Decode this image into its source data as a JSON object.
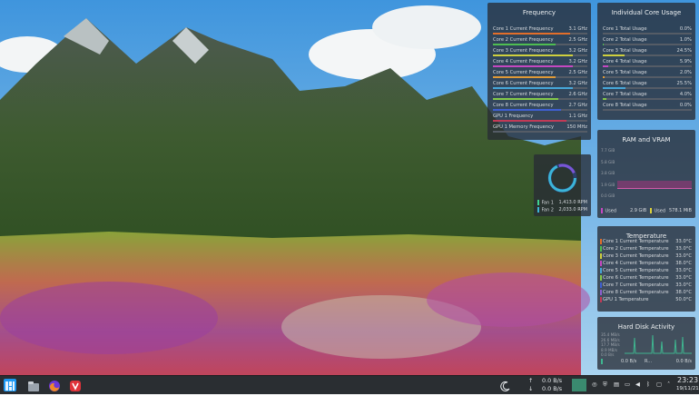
{
  "widgets": {
    "frequency": {
      "title": "Frequency",
      "rows": [
        {
          "label": "Core 1 Current Frequency",
          "value": "3.1 GHz",
          "color": "#e36e2a",
          "fraction": 0.82
        },
        {
          "label": "Core 2 Current Frequency",
          "value": "2.5 GHz",
          "color": "#4fbd51",
          "fraction": 0.66
        },
        {
          "label": "Core 3 Current Frequency",
          "value": "3.2 GHz",
          "color": "#cfcf3e",
          "fraction": 0.85
        },
        {
          "label": "Core 4 Current Frequency",
          "value": "3.2 GHz",
          "color": "#c548c1",
          "fraction": 0.85
        },
        {
          "label": "Core 5 Current Frequency",
          "value": "2.5 GHz",
          "color": "#e09a37",
          "fraction": 0.66
        },
        {
          "label": "Core 6 Current Frequency",
          "value": "3.2 GHz",
          "color": "#47a6d8",
          "fraction": 0.85
        },
        {
          "label": "Core 7 Current Frequency",
          "value": "2.6 GHz",
          "color": "#84c94a",
          "fraction": 0.69
        },
        {
          "label": "Core 8 Current Frequency",
          "value": "2.7 GHz",
          "color": "#3f5fd1",
          "fraction": 0.72
        },
        {
          "label": "GPU 1 Frequency",
          "value": "1.1 GHz",
          "color": "#c23a57",
          "fraction": 0.78
        },
        {
          "label": "GPU 1 Memory Frequency",
          "value": "150 MHz",
          "color": "#555c66",
          "fraction": 0.0
        }
      ]
    },
    "cores": {
      "title": "Individual Core Usage",
      "rows": [
        {
          "label": "Core 1 Total Usage",
          "value": "0.0%",
          "color": "#e36e2a",
          "fraction": 0.0
        },
        {
          "label": "Core 2 Total Usage",
          "value": "1.0%",
          "color": "#4fbd51",
          "fraction": 0.01
        },
        {
          "label": "Core 3 Total Usage",
          "value": "24.5%",
          "color": "#cfcf3e",
          "fraction": 0.245
        },
        {
          "label": "Core 4 Total Usage",
          "value": "5.9%",
          "color": "#c548c1",
          "fraction": 0.059
        },
        {
          "label": "Core 5 Total Usage",
          "value": "2.0%",
          "color": "#e09a37",
          "fraction": 0.02
        },
        {
          "label": "Core 6 Total Usage",
          "value": "25.5%",
          "color": "#47a6d8",
          "fraction": 0.255
        },
        {
          "label": "Core 7 Total Usage",
          "value": "4.0%",
          "color": "#84c94a",
          "fraction": 0.04
        },
        {
          "label": "Core 8 Total Usage",
          "value": "0.0%",
          "color": "#3f5fd1",
          "fraction": 0.0
        }
      ]
    },
    "fans": {
      "fan1_label": "Fan 1",
      "fan1_value": "1,413.0 RPM",
      "fan2_label": "Fan 2",
      "fan2_value": "2,033.0 RPM"
    },
    "ram": {
      "title": "RAM and VRAM",
      "ticks": [
        "7.7 GiB",
        "5.8 GiB",
        "3.8 GiB",
        "1.9 GiB",
        "0.0 GiB"
      ],
      "used_label": "Used",
      "used_value": "2.9 GiB",
      "vram_label": "Used",
      "vram_value": "578.1 MiB"
    },
    "temperature": {
      "title": "Temperature",
      "rows": [
        {
          "label": "Core 1 Current Temperature",
          "value": "33.0°C",
          "color": "#e36e2a"
        },
        {
          "label": "Core 2 Current Temperature",
          "value": "33.0°C",
          "color": "#4fbd51"
        },
        {
          "label": "Core 3 Current Temperature",
          "value": "33.0°C",
          "color": "#cfcf3e"
        },
        {
          "label": "Core 4 Current Temperature",
          "value": "38.0°C",
          "color": "#c548c1"
        },
        {
          "label": "Core 5 Current Temperature",
          "value": "33.0°C",
          "color": "#47a6d8"
        },
        {
          "label": "Core 6 Current Temperature",
          "value": "33.0°C",
          "color": "#84c94a"
        },
        {
          "label": "Core 7 Current Temperature",
          "value": "33.0°C",
          "color": "#3f5fd1"
        },
        {
          "label": "Core 8 Current Temperature",
          "value": "38.0°C",
          "color": "#8c5fd0"
        },
        {
          "label": "GPU 1 Temperature",
          "value": "50.0°C",
          "color": "#c23a57"
        }
      ]
    },
    "disk": {
      "title": "Hard Disk Activity",
      "ticks": [
        "35.4 MB/s",
        "26.6 MB/s",
        "17.7 MB/s",
        "8.9 MB/s",
        "0.0 B/s"
      ],
      "read_label": "0.0 B/s",
      "read_marker": "R...",
      "write_label": "0.0 B/s"
    }
  },
  "taskbar": {
    "net_up": "0.0 B/s",
    "net_down": "0.0 B/s",
    "time": "23:23",
    "date": "19/11/21"
  }
}
